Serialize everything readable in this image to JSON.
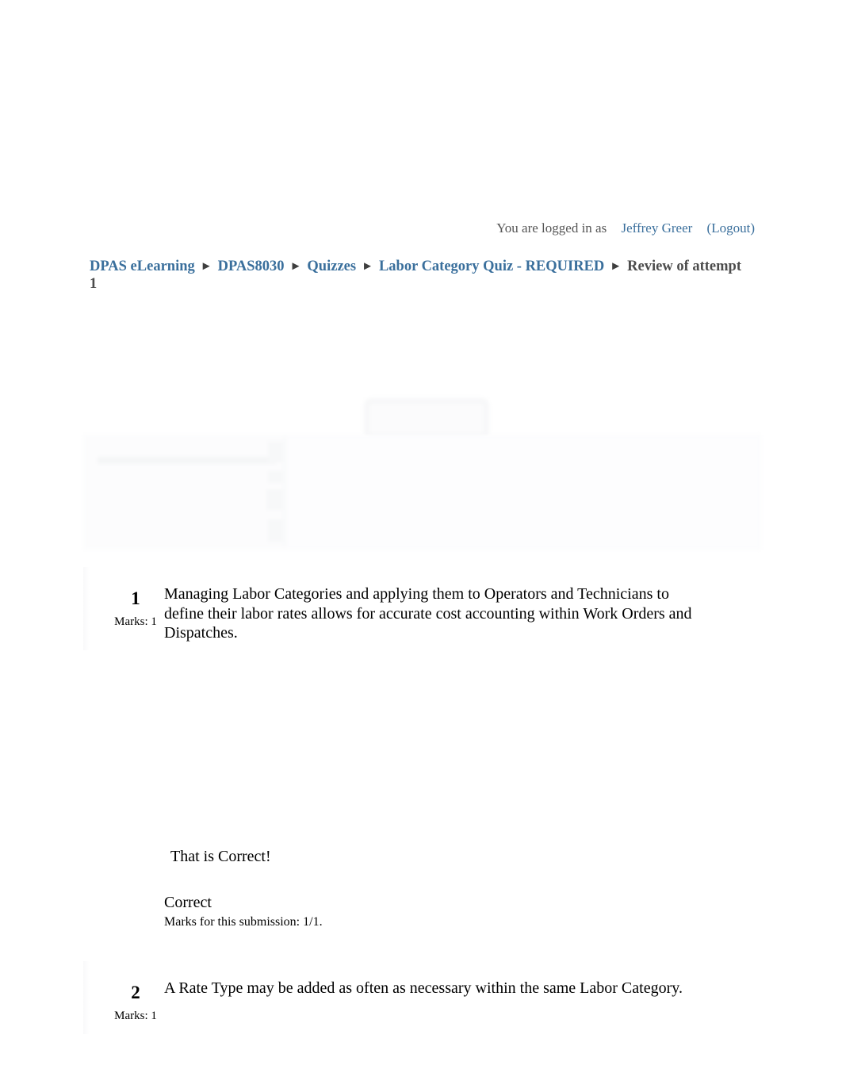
{
  "header": {
    "logged_in_prefix": "You are logged in as",
    "user_name": "Jeffrey Greer",
    "paren_open": "(",
    "logout_label": "Logout",
    "paren_close": ")"
  },
  "breadcrumb": {
    "separator": "►",
    "items": [
      {
        "label": "DPAS eLearning",
        "is_link": true
      },
      {
        "label": "DPAS8030",
        "is_link": true
      },
      {
        "label": "Quizzes",
        "is_link": true
      },
      {
        "label": "Labor Category Quiz - REQUIRED",
        "is_link": true
      },
      {
        "label": "Review of attempt 1",
        "is_link": false
      }
    ]
  },
  "summary_panel": {
    "visible": true,
    "obscured": true,
    "description": "blurred quiz attempt summary table"
  },
  "questions": [
    {
      "number": "1",
      "marks_label": "Marks: 1",
      "text": "Managing Labor Categories and applying them to Operators and Technicians to define their labor rates allows for accurate cost accounting within Work Orders and Dispatches.",
      "feedback": {
        "banner": "That is Correct!",
        "grade_label": "Correct",
        "marks_line": "Marks for this submission: 1/1."
      }
    },
    {
      "number": "2",
      "marks_label": "Marks: 1",
      "text": "A Rate Type may be added as often as necessary within the same Labor Category."
    }
  ],
  "colors": {
    "link": "#3a6f9c",
    "breadcrumb_current": "#4c4c4c",
    "body_text": "#000000",
    "page_background": "#ffffff"
  }
}
